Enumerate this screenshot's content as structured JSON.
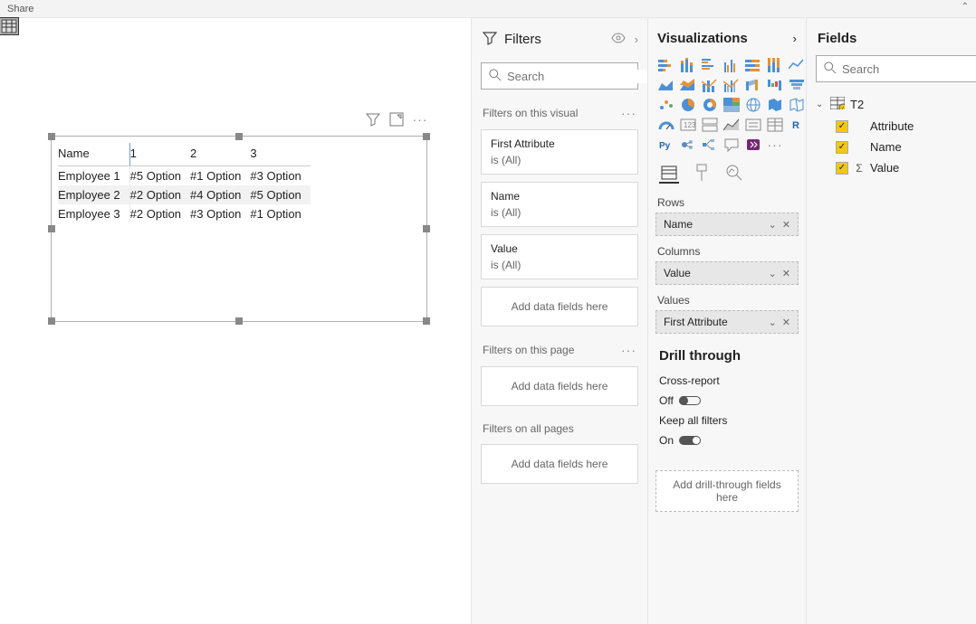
{
  "topbar": {
    "share": "Share"
  },
  "matrix": {
    "headers": [
      "Name",
      "1",
      "2",
      "3"
    ],
    "rows": [
      {
        "name": "Employee 1",
        "c1": "#5 Option",
        "c2": "#1 Option",
        "c3": "#3 Option"
      },
      {
        "name": "Employee 2",
        "c1": "#2 Option",
        "c2": "#4 Option",
        "c3": "#5 Option"
      },
      {
        "name": "Employee 3",
        "c1": "#2 Option",
        "c2": "#3 Option",
        "c3": "#1 Option"
      }
    ]
  },
  "filters": {
    "title": "Filters",
    "search_placeholder": "Search",
    "section_visual": "Filters on this visual",
    "cards": [
      {
        "field": "First Attribute",
        "cond": "is (All)"
      },
      {
        "field": "Name",
        "cond": "is (All)"
      },
      {
        "field": "Value",
        "cond": "is (All)"
      }
    ],
    "add_visual": "Add data fields here",
    "section_page": "Filters on this page",
    "add_page": "Add data fields here",
    "section_all": "Filters on all pages",
    "add_all": "Add data fields here"
  },
  "viz": {
    "title": "Visualizations",
    "wells": {
      "rows_label": "Rows",
      "rows_chip": "Name",
      "cols_label": "Columns",
      "cols_chip": "Value",
      "vals_label": "Values",
      "vals_chip": "First Attribute"
    },
    "drill": {
      "title": "Drill through",
      "cross_label": "Cross-report",
      "cross_state": "Off",
      "keep_label": "Keep all filters",
      "keep_state": "On",
      "drop": "Add drill-through fields here"
    }
  },
  "fields": {
    "title": "Fields",
    "search_placeholder": "Search",
    "table": "T2",
    "items": [
      "Attribute",
      "Name",
      "Value"
    ]
  }
}
